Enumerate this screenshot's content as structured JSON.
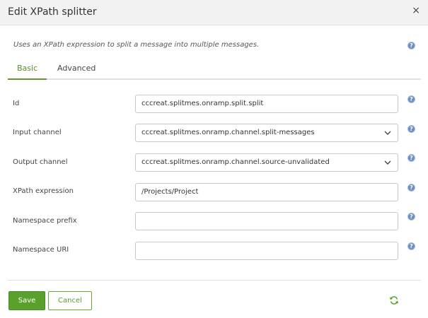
{
  "dialog": {
    "title": "Edit XPath splitter",
    "close_glyph": "×",
    "description": "Uses an XPath expression to split a message into multiple messages."
  },
  "tabs": [
    {
      "label": "Basic",
      "active": true
    },
    {
      "label": "Advanced",
      "active": false
    }
  ],
  "fields": {
    "id": {
      "label": "Id",
      "value": "cccreat.splitmes.onramp.split.split"
    },
    "input_channel": {
      "label": "Input channel",
      "value": "cccreat.splitmes.onramp.channel.split-messages"
    },
    "output_channel": {
      "label": "Output channel",
      "value": "cccreat.splitmes.onramp.channel.source-unvalidated"
    },
    "xpath_expression": {
      "label": "XPath expression",
      "value": "/Projects/Project"
    },
    "namespace_prefix": {
      "label": "Namespace prefix",
      "value": ""
    },
    "namespace_uri": {
      "label": "Namespace URI",
      "value": ""
    }
  },
  "help_glyph": "?",
  "footer": {
    "save_label": "Save",
    "cancel_label": "Cancel"
  },
  "icons": {
    "close": "close-icon",
    "help": "help-icon",
    "chevron": "chevron-down-icon",
    "refresh": "refresh-icon"
  },
  "colors": {
    "accent_green": "#5aa02c",
    "help_blue": "#6d8fbf",
    "header_bg": "#f2f2f2"
  }
}
